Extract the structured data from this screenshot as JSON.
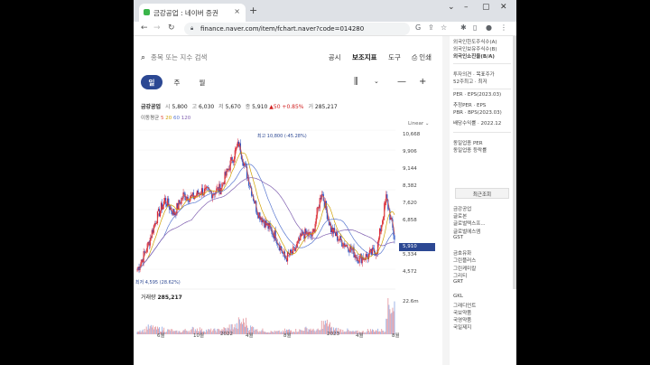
{
  "browser": {
    "tab_title": "금강공업 : 네이버 증권",
    "tab_close": "×",
    "new_tab": "+",
    "url": "finance.naver.com/item/fchart.naver?code=014280",
    "win_controls": [
      "⌄",
      "–",
      "▢",
      "✕"
    ]
  },
  "header": {
    "search_placeholder": "종목 또는 지수 검색",
    "links": [
      "공시",
      "보조지표",
      "도구",
      "인쇄"
    ]
  },
  "periods": [
    "일",
    "주",
    "월"
  ],
  "periods_selected": 0,
  "info": {
    "name": "금강공업",
    "open_label": "시",
    "open": "5,800",
    "high_label": "고",
    "high": "6,030",
    "low_label": "저",
    "low": "5,670",
    "close_label": "종",
    "close": "5,910",
    "change": "▲50 +0.85%",
    "vol_label": "거",
    "volume": "285,217"
  },
  "ma": {
    "label": "이동평균",
    "p1": "5",
    "p2": "20",
    "p3": "60",
    "p4": "120"
  },
  "scale_label": "Linear",
  "y_ticks": [
    "10,668",
    "9,906",
    "9,144",
    "8,382",
    "7,620",
    "6,858",
    "5,334",
    "4,572"
  ],
  "current_price_tag": "5,910",
  "high_marker": "최고 10,800 (-45.28%)",
  "low_marker": "최저 4,595 (28.62%)",
  "volume_panel": {
    "label": "거래량",
    "value": "285,217",
    "axis": "22.6m"
  },
  "x_ticks": [
    "6월",
    "10월",
    "2022",
    "4월",
    "8월",
    "2023",
    "4월",
    "8월"
  ],
  "sidebar": {
    "top_items": [
      "외국인한도주식수(A)",
      "외국인보유주식수(B)",
      "외국인소진율(B/A)"
    ],
    "mid_items": [
      "투자의견 · 목표주가",
      "52주최고 · 최저"
    ],
    "per_items": [
      "PER · EPS(2023.03)",
      "추정PER · EPS",
      "PBR · BPS(2023.03)",
      "배당수익률 · 2022.12"
    ],
    "sector_items": [
      "동일업종 PER",
      "동일업종 등락률"
    ],
    "recent_head": "최근조회",
    "recent_items": [
      "금강공업",
      "글로본",
      "글로벌텍스프...",
      "글로벌에스엠",
      "GST",
      "",
      "금호유화",
      "그린플러스",
      "그린케미칼",
      "그리티",
      "GRT",
      "",
      "GKL",
      "그래디언트",
      "국보약품",
      "국영약품",
      "국일제지"
    ]
  },
  "chart_data": {
    "type": "candlestick",
    "title": "금강공업",
    "ylim": [
      4400,
      10900
    ],
    "yscale": "linear",
    "x": [
      "2021-05",
      "2021-06",
      "2021-07",
      "2021-08",
      "2021-09",
      "2021-10",
      "2021-11",
      "2021-12",
      "2022-01",
      "2022-02",
      "2022-03",
      "2022-04",
      "2022-05",
      "2022-06",
      "2022-07",
      "2022-08",
      "2022-09",
      "2022-10",
      "2022-11",
      "2022-12",
      "2023-01",
      "2023-02",
      "2023-03",
      "2023-04",
      "2023-05",
      "2023-06",
      "2023-07",
      "2023-08",
      "2023-09"
    ],
    "close": [
      4700,
      5600,
      6900,
      7800,
      7200,
      8000,
      7900,
      8200,
      8100,
      8300,
      9300,
      10300,
      8800,
      7300,
      6700,
      6200,
      5200,
      5500,
      6300,
      6200,
      8200,
      6500,
      6000,
      5700,
      5200,
      5300,
      5600,
      7900,
      5910
    ],
    "series_ma": [
      {
        "name": "5",
        "color": "#e05040"
      },
      {
        "name": "20",
        "color": "#d0a000"
      },
      {
        "name": "60",
        "color": "#5a78d0"
      },
      {
        "name": "120",
        "color": "#8060b0"
      }
    ],
    "volume": [
      3,
      5,
      4,
      3,
      2,
      3,
      4,
      3,
      3,
      4,
      6,
      9,
      5,
      3,
      2,
      2,
      3,
      3,
      4,
      3,
      8,
      4,
      3,
      2,
      2,
      3,
      3,
      22,
      6
    ],
    "colors": {
      "up": "#d9263a",
      "down": "#2b55c7"
    }
  }
}
